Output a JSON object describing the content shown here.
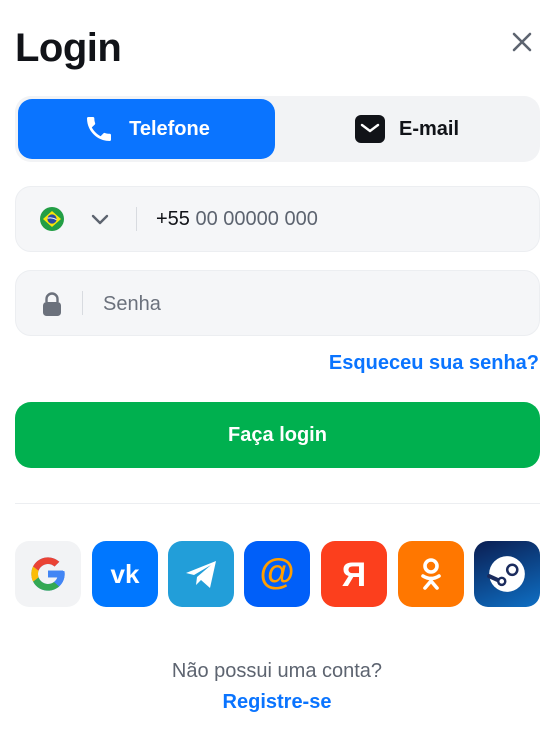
{
  "header": {
    "title": "Login"
  },
  "tabs": [
    {
      "label": "Telefone",
      "icon": "phone-icon",
      "active": true
    },
    {
      "label": "E-mail",
      "icon": "mail-icon",
      "active": false
    }
  ],
  "phone": {
    "country_flag": "brazil-flag-icon",
    "country_code": "+55",
    "placeholder": "00 00000 000"
  },
  "password": {
    "placeholder": "Senha"
  },
  "forgot_password": "Esqueceu sua senha?",
  "login_button": "Faça login",
  "social_providers": [
    "google",
    "vk",
    "telegram",
    "mail-ru",
    "yandex",
    "odnoklassniki",
    "steam"
  ],
  "footer": {
    "no_account_text": "Não possui uma conta?",
    "register_link": "Registre-se"
  },
  "colors": {
    "primary_blue": "#0a74ff",
    "login_green": "#00b04f",
    "field_bg": "#f5f6f8"
  }
}
